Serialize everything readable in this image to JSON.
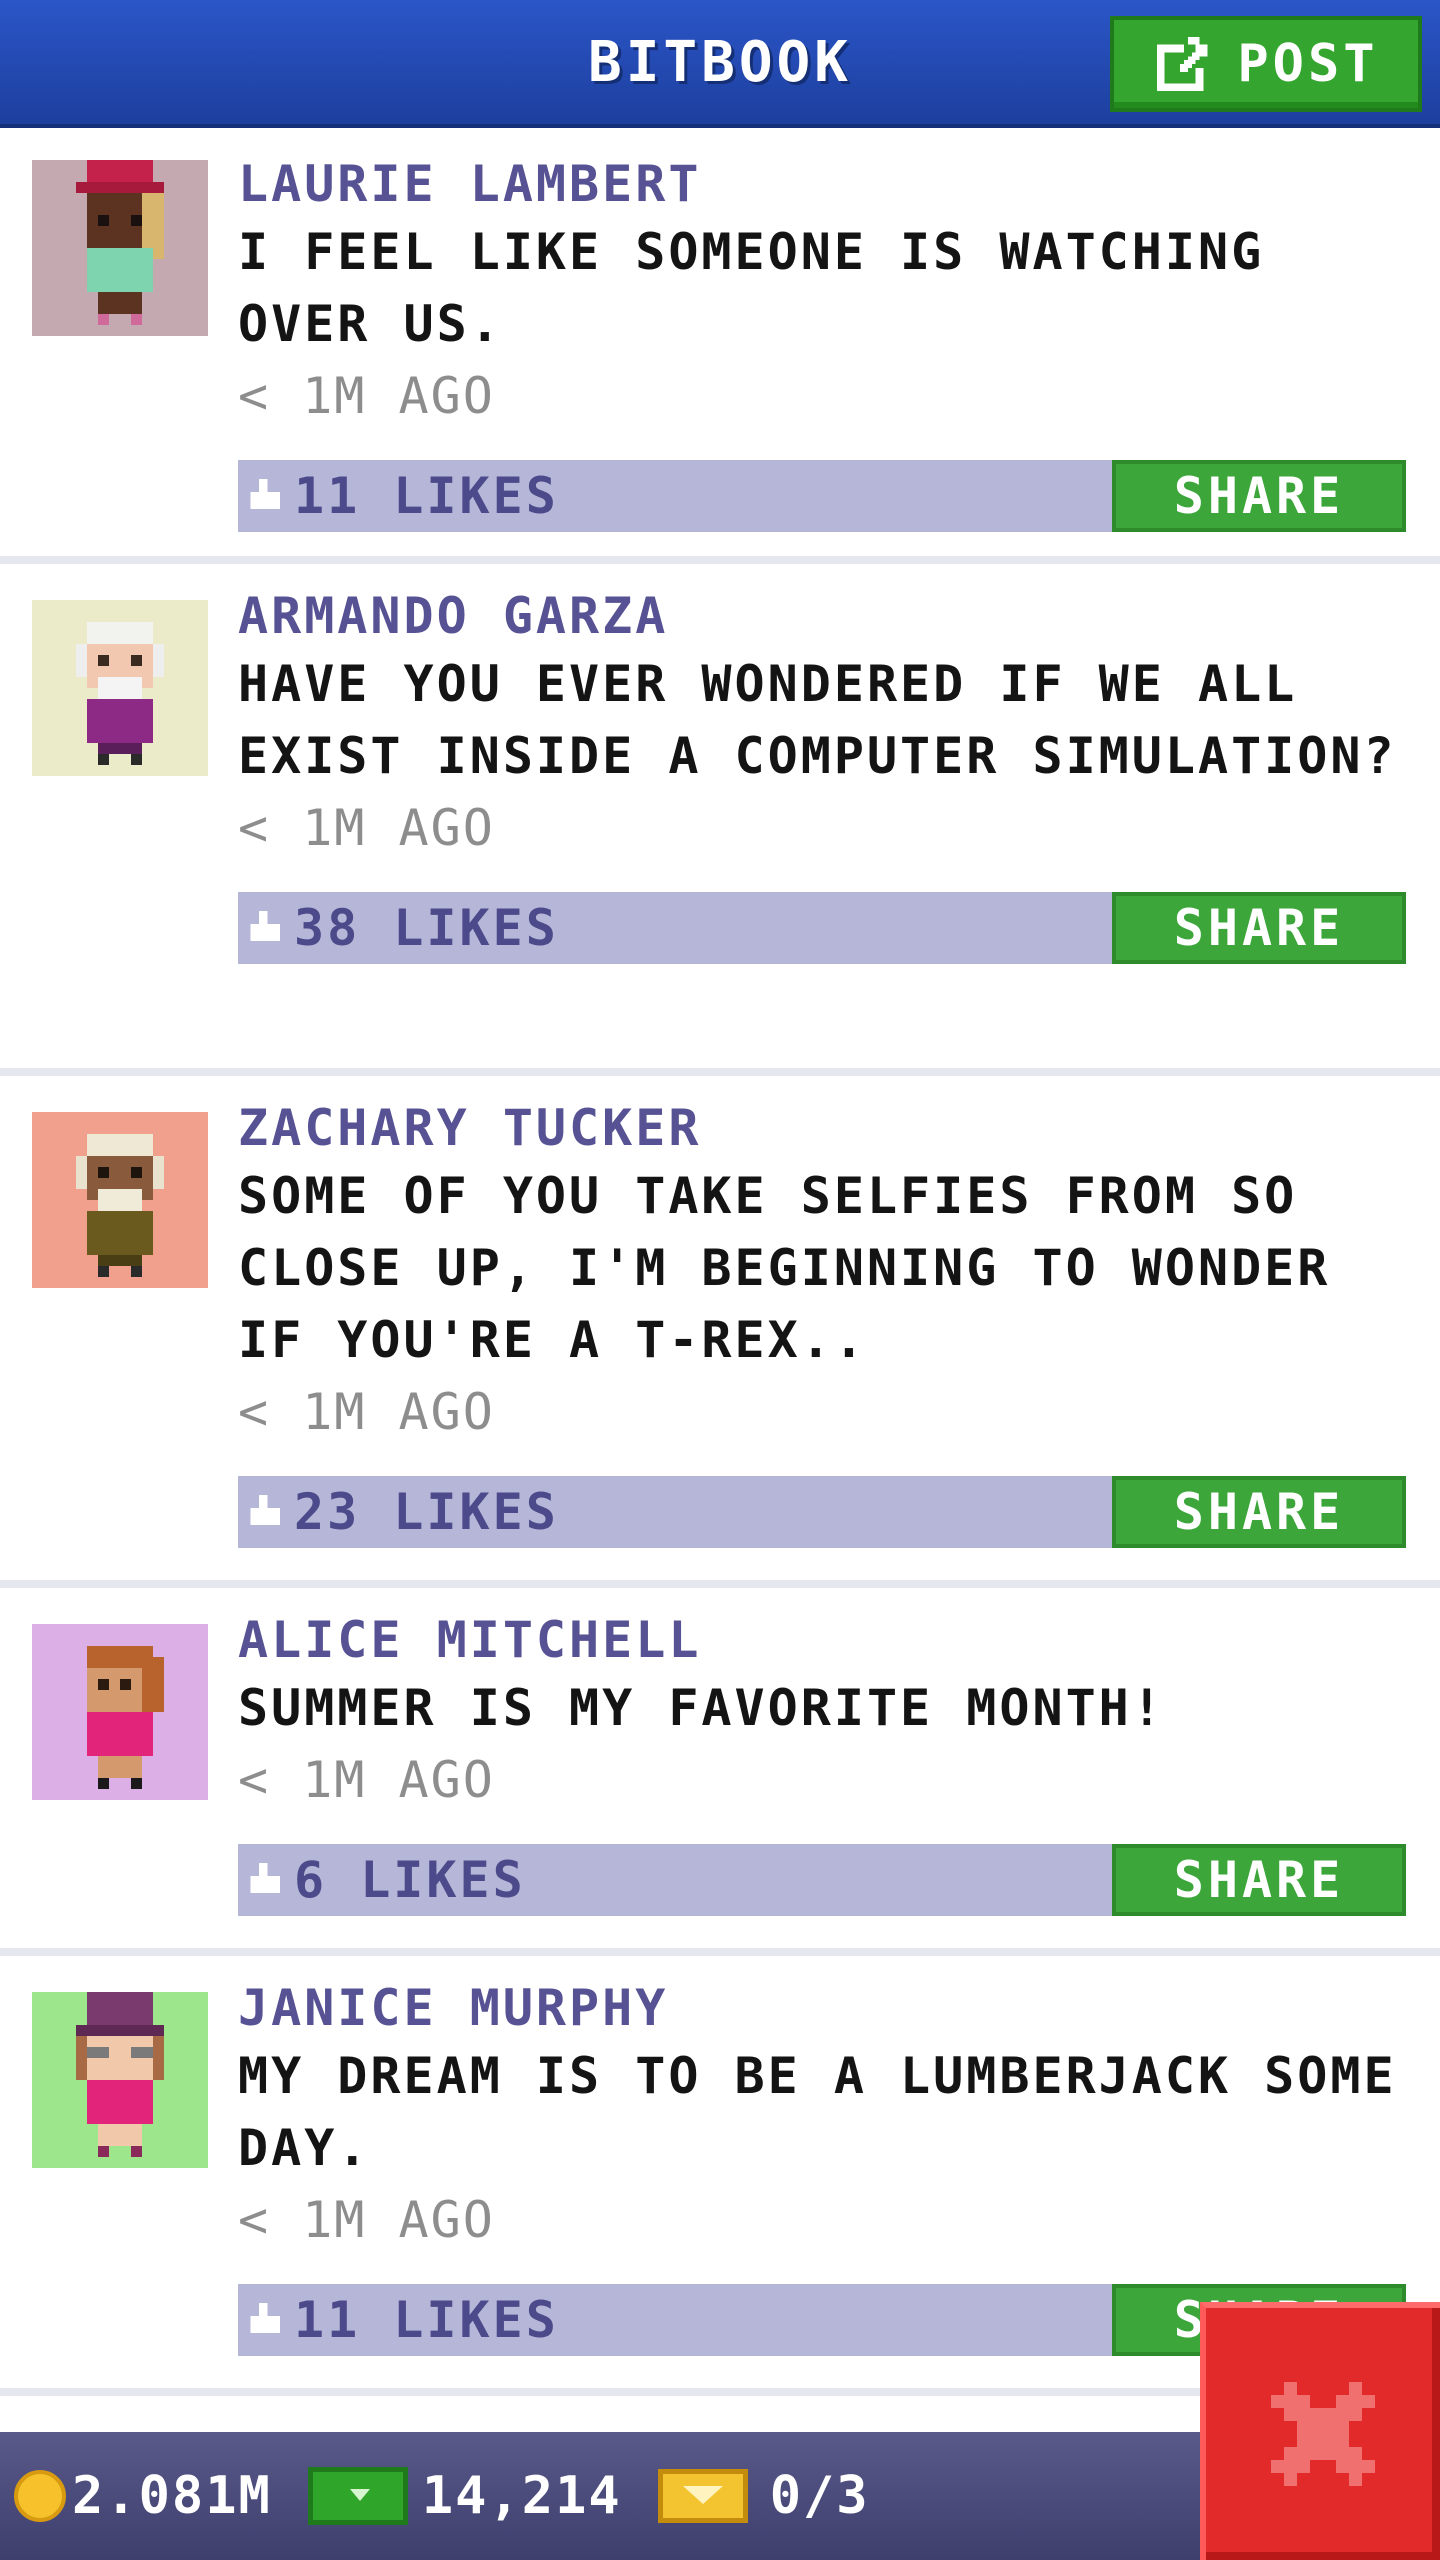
{
  "app": {
    "title": "BITBOOK",
    "post_button": "POST"
  },
  "colors": {
    "header_blue": "#2b56c8",
    "post_green": "#34a52e",
    "share_green": "#3ca63a",
    "like_bar": "#b6b7d8",
    "author_purple": "#565293",
    "close_red": "#e22a2a"
  },
  "posts": [
    {
      "author": "LAURIE LAMBERT",
      "message": "I FEEL LIKE SOMEONE IS WATCHING OVER US.",
      "time": "< 1M AGO",
      "likes": "11 LIKES",
      "share": "SHARE"
    },
    {
      "author": "ARMANDO GARZA",
      "message": "HAVE YOU EVER WONDERED IF WE ALL EXIST INSIDE A COMPUTER SIMULATION?",
      "time": "< 1M AGO",
      "likes": "38 LIKES",
      "share": "SHARE"
    },
    {
      "author": "ZACHARY TUCKER",
      "message": "SOME OF YOU TAKE SELFIES FROM SO CLOSE UP, I'M BEGINNING TO WONDER IF YOU'RE A T-REX..",
      "time": "< 1M AGO",
      "likes": "23 LIKES",
      "share": "SHARE"
    },
    {
      "author": "ALICE MITCHELL",
      "message": "SUMMER IS MY FAVORITE MONTH!",
      "time": "< 1M AGO",
      "likes": "6 LIKES",
      "share": "SHARE"
    },
    {
      "author": "JANICE MURPHY",
      "message": "MY DREAM IS TO BE A LUMBERJACK SOME DAY.",
      "time": "< 1M AGO",
      "likes": "11 LIKES",
      "share": "SHARE"
    }
  ],
  "footer": {
    "coins": "2.081M",
    "cash": "14,214",
    "tickets": "0/3"
  },
  "icons": {
    "post": "edit-icon",
    "like": "thumbs-up-icon",
    "coin": "coin-icon",
    "cash": "cash-icon",
    "ticket": "ticket-icon",
    "close": "close-icon"
  }
}
